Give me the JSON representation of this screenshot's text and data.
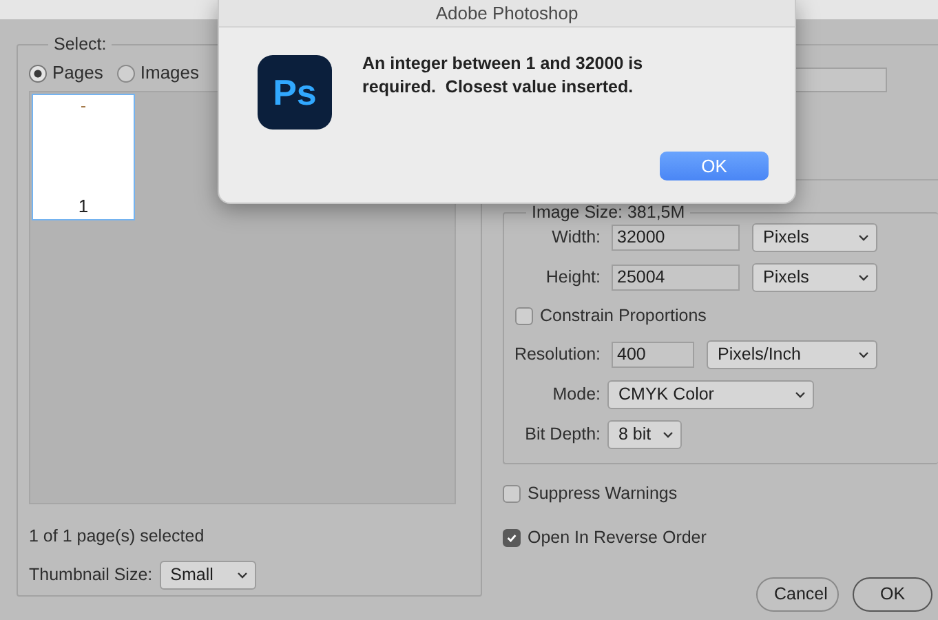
{
  "alert": {
    "title": "Adobe Photoshop",
    "icon_text": "Ps",
    "message": "An integer between 1 and 32000 is required.  Closest value inserted.",
    "button": "OK"
  },
  "select": {
    "legend": "Select:",
    "options": [
      {
        "label": "Pages",
        "selected": true
      },
      {
        "label": "Images",
        "selected": false
      }
    ],
    "thumbnails": [
      {
        "label": "1",
        "selected": true
      }
    ],
    "status": "1 of 1 page(s) selected",
    "thumbnail_size": {
      "label": "Thumbnail Size:",
      "value": "Small"
    }
  },
  "image_size": {
    "legend": "Image Size: 381,5M",
    "rows": [
      {
        "kind": "field",
        "label": "Width:",
        "value": "32000",
        "unit": "Pixels"
      },
      {
        "kind": "field",
        "label": "Height:",
        "value": "25004",
        "unit": "Pixels"
      },
      {
        "kind": "check",
        "label": "Constrain Proportions",
        "checked": false
      },
      {
        "kind": "field",
        "label": "Resolution:",
        "value": "400",
        "unit": "Pixels/Inch"
      },
      {
        "kind": "select",
        "label": "Mode:",
        "value": "CMYK Color"
      },
      {
        "kind": "select",
        "label": "Bit Depth:",
        "value": "8 bit"
      }
    ]
  },
  "options": [
    {
      "label": "Suppress Warnings",
      "checked": false
    },
    {
      "label": "Open In Reverse Order",
      "checked": true
    }
  ],
  "buttons": [
    {
      "label": "Cancel",
      "kind": "secondary"
    },
    {
      "label": "OK",
      "kind": "default"
    }
  ]
}
